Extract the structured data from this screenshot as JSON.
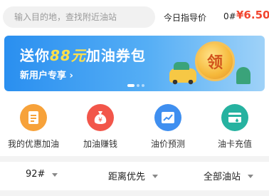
{
  "search": {
    "placeholder": "输入目的地，查找附近油站"
  },
  "price": {
    "label": "今日指导价",
    "grade": "0#",
    "value": "¥6.50"
  },
  "banner": {
    "title_prefix": "送你",
    "title_amount": "88元",
    "title_suffix": "加油券包",
    "subtitle": "新用户专享 ›",
    "coin_text": "领"
  },
  "quick": [
    {
      "label": "我的优惠加油",
      "icon": "document-icon",
      "color": "#f7a23a"
    },
    {
      "label": "加油赚钱",
      "icon": "money-bag-icon",
      "color": "#f2564a"
    },
    {
      "label": "油价预测",
      "icon": "trend-chart-icon",
      "color": "#3f8ff0"
    },
    {
      "label": "油卡充值",
      "icon": "fuel-card-icon",
      "color": "#26b2a0"
    }
  ],
  "filters": {
    "grade": "92#",
    "sort": "距离优先",
    "stations": "全部油站"
  }
}
